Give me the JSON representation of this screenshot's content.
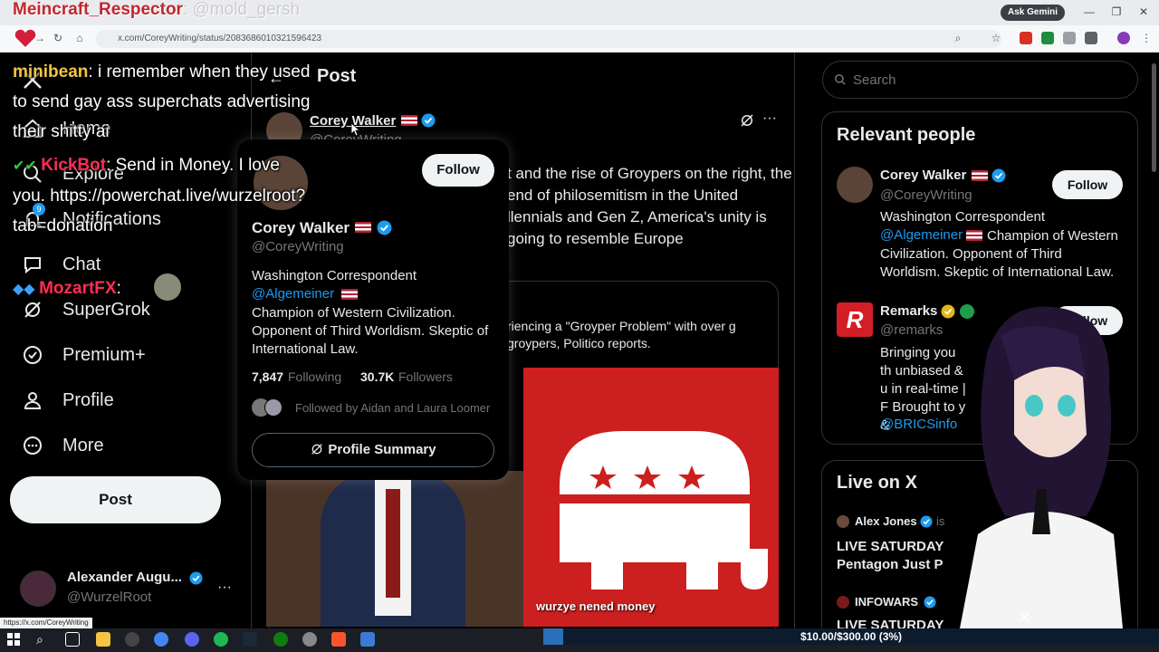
{
  "browser": {
    "ask_gemini": "Ask Gemini",
    "url": "x.com/CoreyWriting/status/2083686010321596423",
    "status_url": "https://x.com/CoreyWriting"
  },
  "stream_overlay": {
    "top_line_name": "Meincraft_Respector",
    "top_line_text": ": @mold_gersh",
    "chat": [
      {
        "name": "minibean",
        "text": ": i remember when they used to send gay ass superchats advertising their shitty ai"
      },
      {
        "name": "KickBot",
        "text": ": Send in Money. I love you.  https://powerchat.live/wurzelroot?tab=donation"
      },
      {
        "name": "MozartFX",
        "text": ":"
      }
    ],
    "donation_goal": "$10.00/$300.00 (3%)",
    "donation_fraction": 0.033,
    "card_caption": "wurzye nened money"
  },
  "nav": {
    "items": [
      {
        "label": "Home",
        "icon": "home-icon"
      },
      {
        "label": "Explore",
        "icon": "search-icon"
      },
      {
        "label": "Notifications",
        "icon": "bell-icon",
        "badge": "9"
      },
      {
        "label": "Chat",
        "icon": "chat-icon"
      },
      {
        "label": "SuperGrok",
        "icon": "grok-icon"
      },
      {
        "label": "Premium+",
        "icon": "verified-icon"
      },
      {
        "label": "Profile",
        "icon": "person-icon"
      },
      {
        "label": "More",
        "icon": "more-icon"
      }
    ],
    "post_button": "Post",
    "account": {
      "name": "Alexander Augu...",
      "handle": "@WurzelRoot"
    }
  },
  "post": {
    "header": "Post",
    "author_name": "Corey Walker",
    "author_handle": "@CoreyWriting",
    "text": "t and the rise of Groypers on the right, the end of philosemitism in the United llennials and Gen Z, America's unity is going to resemble Europe",
    "card_text": "riencing a \"Groyper Problem\" with over g groypers, Politico reports."
  },
  "hover_card": {
    "name": "Corey Walker",
    "handle": "@CoreyWriting",
    "follow": "Follow",
    "bio_line1": "Washington Correspondent",
    "bio_link": "@Algemeiner",
    "bio_rest": "Champion of Western Civilization. Opponent of Third Worldism. Skeptic of International Law.",
    "following_count": "7,847",
    "following_label": "Following",
    "followers_count": "30.7K",
    "followers_label": "Followers",
    "followed_by": "Followed by Aidan and Laura Loomer",
    "summary_button": "Profile Summary"
  },
  "right": {
    "search_placeholder": "Search",
    "relevant_title": "Relevant people",
    "people": [
      {
        "name": "Corey Walker",
        "handle": "@CoreyWriting",
        "follow": "Follow",
        "bio_line1": "Washington Correspondent",
        "bio_link": "@Algemeiner",
        "bio_rest": "Champion of Western Civilization. Opponent of Third Worldism. Skeptic of International Law."
      },
      {
        "name": "Remarks",
        "handle": "@remarks",
        "follow": "Follow",
        "bio": "Bringing you th unbiased & u in real-time | F Brought to y &",
        "bio_link": "@BRICSinfo"
      }
    ],
    "live_title": "Live on X",
    "live": [
      {
        "name": "Alex Jones",
        "suffix": "is",
        "title": "LIVE SATURDAY Pentagon Just P"
      },
      {
        "name": "INFOWARS",
        "title": "LIVE SATURDAY"
      }
    ]
  },
  "colors": {
    "accent": "#1d9bf0",
    "gop_red": "#cc1f1f",
    "verified_gold": "#e2b719"
  }
}
